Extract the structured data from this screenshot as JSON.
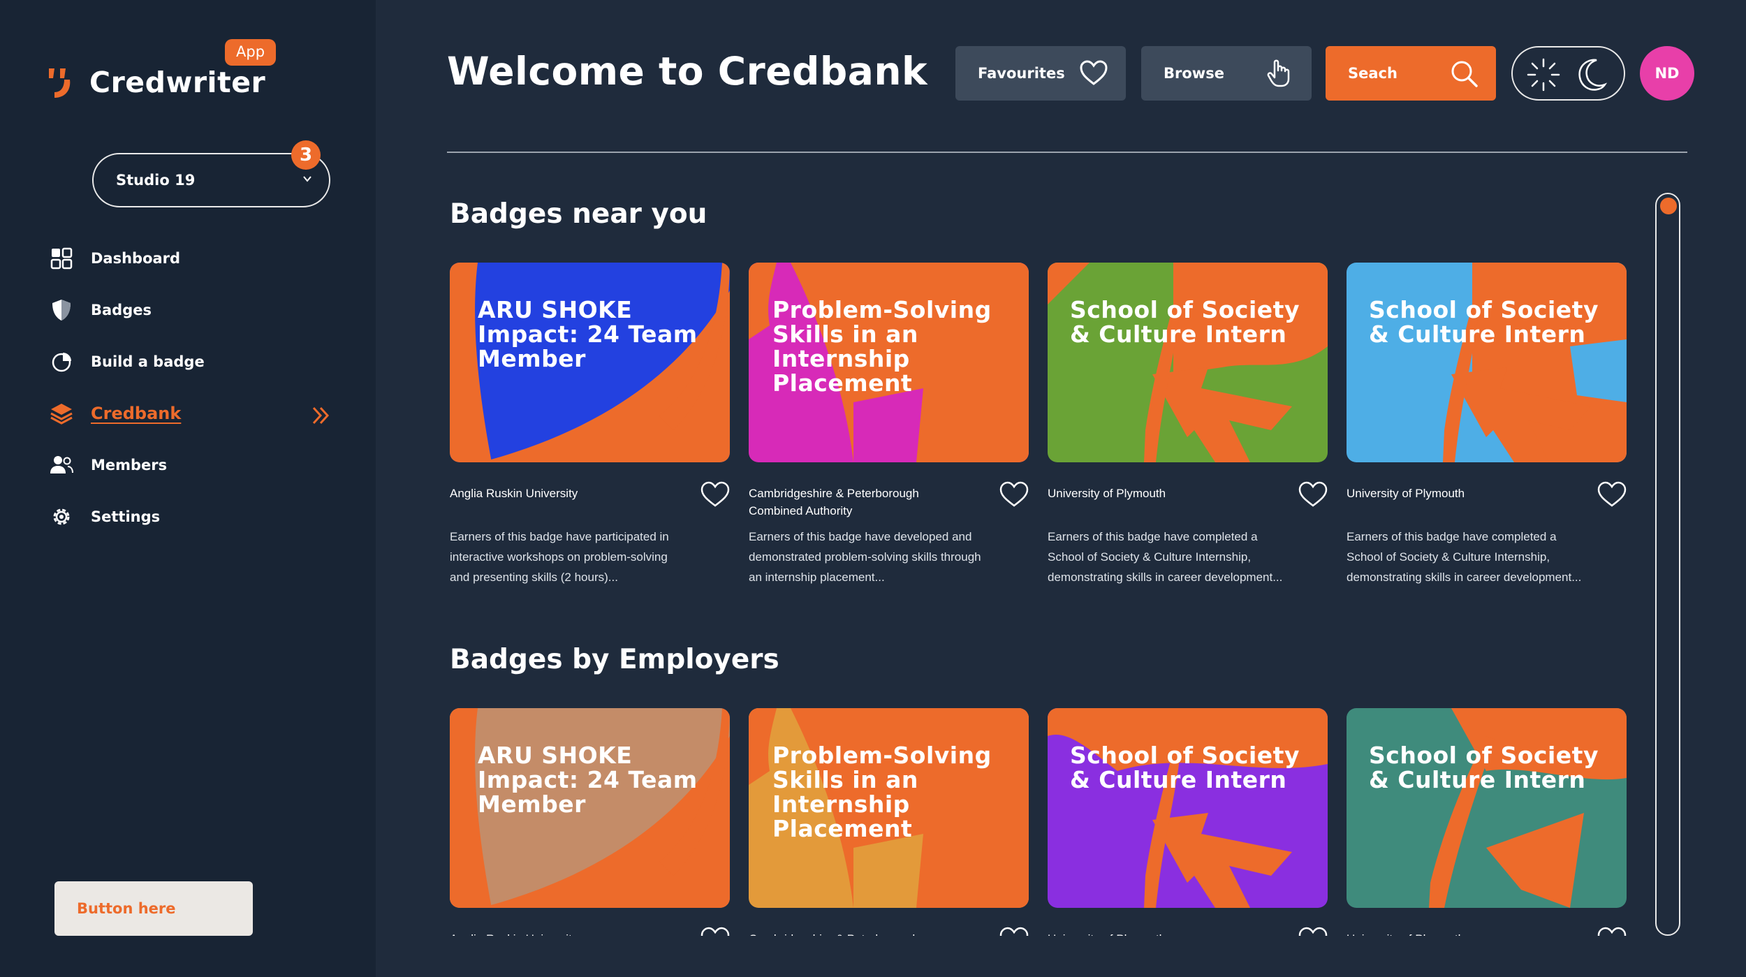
{
  "app": {
    "name": "Credwriter",
    "badge": "App"
  },
  "workspace": {
    "name": "Studio 19",
    "notifications": "3"
  },
  "nav": [
    {
      "label": "Dashboard",
      "icon": "dashboard-icon"
    },
    {
      "label": "Badges",
      "icon": "shield-icon"
    },
    {
      "label": "Build a badge",
      "icon": "pie-chart-icon"
    },
    {
      "label": "Credbank",
      "icon": "layers-icon",
      "active": true
    },
    {
      "label": "Members",
      "icon": "users-icon"
    },
    {
      "label": "Settings",
      "icon": "gear-icon"
    }
  ],
  "sidebar_button": "Button here",
  "header": {
    "title": "Welcome to Credbank",
    "favourites": "Favourites",
    "browse": "Browse",
    "search": "Seach",
    "avatar": "ND"
  },
  "sections": [
    {
      "title": "Badges near you",
      "cards": [
        {
          "title": "ARU SHOKE Impact: 24 Team Member",
          "org": "Anglia Ruskin University",
          "desc": "Earners of this badge have participated in interactive workshops on problem-solving and presenting skills (2 hours)...",
          "bg": "#2341e0",
          "accent": "#ed6b2b"
        },
        {
          "title": "Problem-Solving Skills in an Internship Placement",
          "org": "Cambridgeshire & Peterborough Combined Authority",
          "desc": "Earners of this badge have developed and demonstrated problem-solving skills through an internship placement...",
          "bg": "#d72ab8",
          "accent": "#ed6b2b"
        },
        {
          "title": "School of Society & Culture Intern",
          "org": "University of Plymouth",
          "desc": "Earners of this badge have completed a School of Society & Culture Internship, demonstrating skills in career development...",
          "bg": "#6aa336",
          "accent": "#ed6b2b"
        },
        {
          "title": "School of Society & Culture Intern",
          "org": "University of Plymouth",
          "desc": "Earners of this badge have completed a School of Society & Culture Internship, demonstrating skills in career development...",
          "bg": "#4eaee6",
          "accent": "#ed6b2b"
        }
      ]
    },
    {
      "title": "Badges by Employers",
      "cards": [
        {
          "title": "ARU SHOKE Impact: 24 Team Member",
          "org": "Anglia Ruskin University",
          "bg": "#c48c68",
          "accent": "#ed6b2b"
        },
        {
          "title": "Problem-Solving Skills in an Internship Placement",
          "org": "Cambridgeshire & Peterborough",
          "bg": "#e39a3a",
          "accent": "#ed6b2b"
        },
        {
          "title": "School of Society & Culture Intern",
          "org": "University of Plymouth",
          "bg": "#8a2fe0",
          "accent": "#ed6b2b"
        },
        {
          "title": "School of Society & Culture Intern",
          "org": "University of Plymouth",
          "bg": "#3f8b7c",
          "accent": "#ed6b2b"
        }
      ]
    }
  ],
  "colors": {
    "accent": "#ed6b2b",
    "sidebar": "#182434",
    "main": "#1f2b3c",
    "avatar": "#e83fa9"
  }
}
